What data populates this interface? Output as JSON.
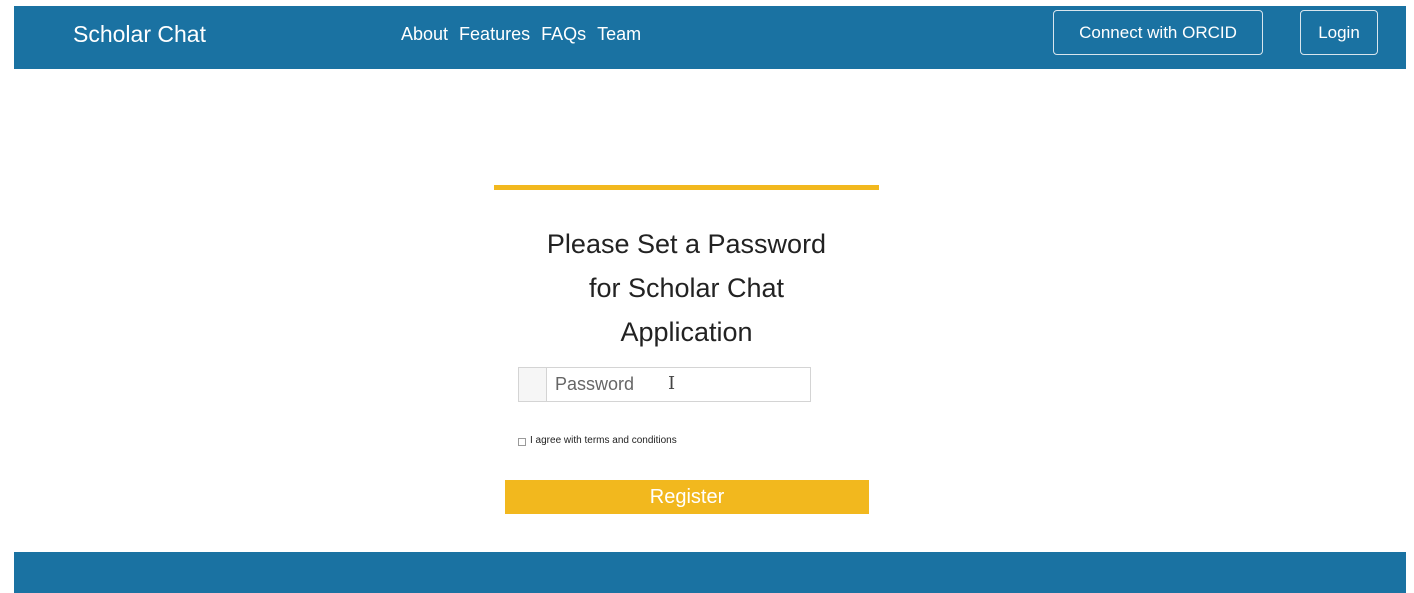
{
  "navbar": {
    "brand": "Scholar Chat",
    "links": [
      "About",
      "Features",
      "FAQs",
      "Team"
    ],
    "orcid_button": "Connect with ORCID",
    "login_button": "Login"
  },
  "card": {
    "title_lines": [
      "Please Set a Password",
      "for Scholar Chat",
      "Application"
    ],
    "password_placeholder": "Password",
    "terms_label": "I agree with terms and conditions",
    "register_button": "Register"
  },
  "colors": {
    "navbar": "#1a72a2",
    "accent": "#f2b81e",
    "footer": "#1a72a2"
  }
}
